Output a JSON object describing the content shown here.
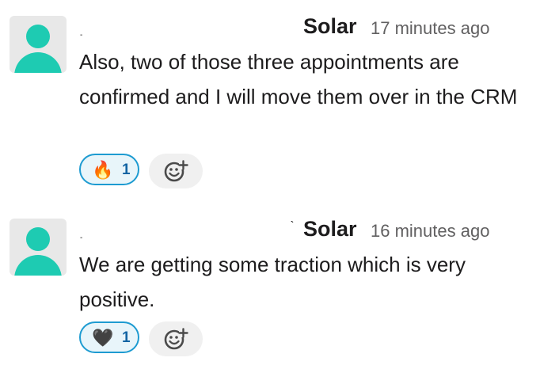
{
  "messages": [
    {
      "mark": "-",
      "author": "Solar",
      "timestamp": "17 minutes ago",
      "text": "Also, two of those three appointments are confirmed and I will move them over in the CRM",
      "reaction": {
        "emoji": "🔥",
        "count": "1"
      }
    },
    {
      "mark": "-",
      "mark_prefix": "`",
      "author": "Solar",
      "timestamp": "16 minutes ago",
      "text": "We are getting some traction which is very positive.",
      "reaction": {
        "emoji": "🖤",
        "count": "1"
      }
    }
  ],
  "colors": {
    "avatar": "#1ecbb2",
    "avatar_bg": "#e8e8e8",
    "reaction_border": "#1d9bd1",
    "reaction_count": "#1264a3",
    "timestamp": "#616061"
  },
  "icons": {
    "avatar": "user-silhouette-icon",
    "add_reaction": "add-reaction-icon"
  }
}
